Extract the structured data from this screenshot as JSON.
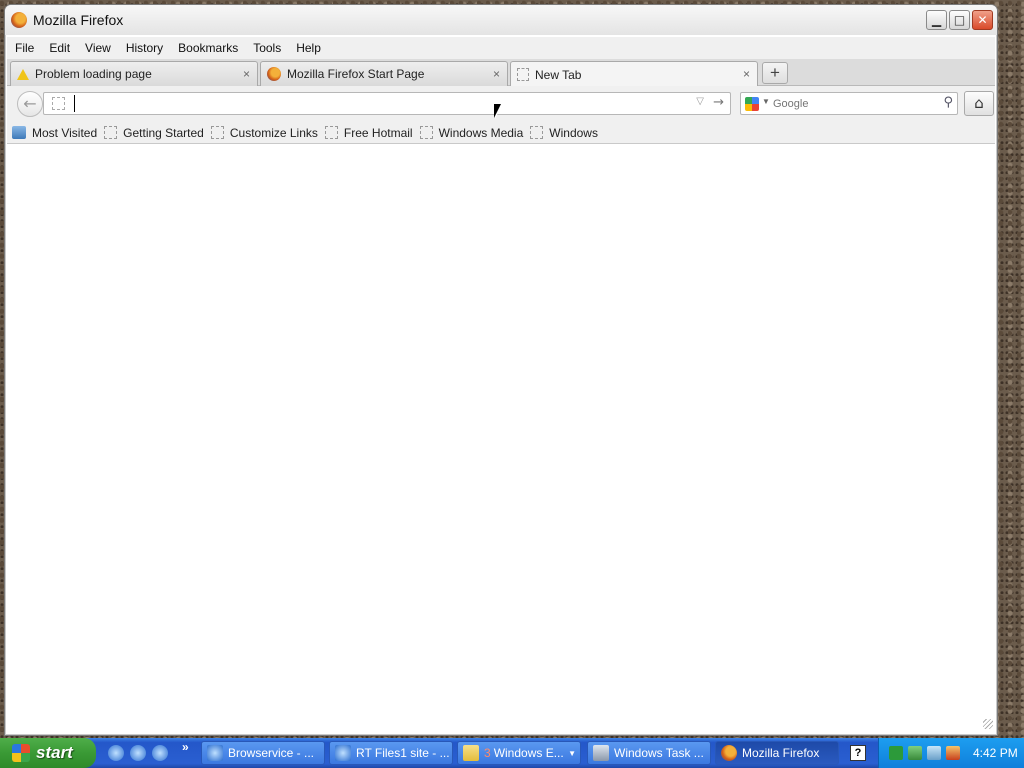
{
  "window": {
    "title": "Mozilla Firefox"
  },
  "menu": {
    "items": [
      {
        "label": "File"
      },
      {
        "label": "Edit"
      },
      {
        "label": "View"
      },
      {
        "label": "History"
      },
      {
        "label": "Bookmarks"
      },
      {
        "label": "Tools"
      },
      {
        "label": "Help"
      }
    ]
  },
  "tabs": [
    {
      "label": "Problem loading page",
      "icon": "warning-icon"
    },
    {
      "label": "Mozilla Firefox Start Page",
      "icon": "firefox-icon"
    },
    {
      "label": "New Tab",
      "icon": "blank-page-icon",
      "active": true
    }
  ],
  "tab_close_glyph": "×",
  "new_tab_glyph": "+",
  "nav": {
    "url_value": "",
    "search_placeholder": "Google",
    "search_engine_icon": "google-icon"
  },
  "bookmarks": [
    {
      "label": "Most Visited",
      "icon": "most-visited-icon"
    },
    {
      "label": "Getting Started",
      "icon": "bookmark-page-icon"
    },
    {
      "label": "Customize Links",
      "icon": "bookmark-page-icon"
    },
    {
      "label": "Free Hotmail",
      "icon": "bookmark-page-icon"
    },
    {
      "label": "Windows Media",
      "icon": "bookmark-page-icon"
    },
    {
      "label": "Windows",
      "icon": "bookmark-page-icon"
    }
  ],
  "taskbar": {
    "start_label": "start",
    "tasks": [
      {
        "label": "Browservice - ...",
        "icon": "ie-icon"
      },
      {
        "label": "RT Files1 site - ...",
        "icon": "ie-icon"
      },
      {
        "count": "3",
        "label": "Windows E...",
        "icon": "folder-icon"
      },
      {
        "label": "Windows Task ...",
        "icon": "task-manager-icon"
      },
      {
        "label": "Mozilla Firefox",
        "icon": "firefox-icon",
        "active": true
      }
    ],
    "clock": "4:42 PM"
  },
  "colors": {
    "taskbar_blue": "#2a5fd1",
    "start_green": "#3a9a35",
    "tray_blue": "#1d9ef0"
  }
}
